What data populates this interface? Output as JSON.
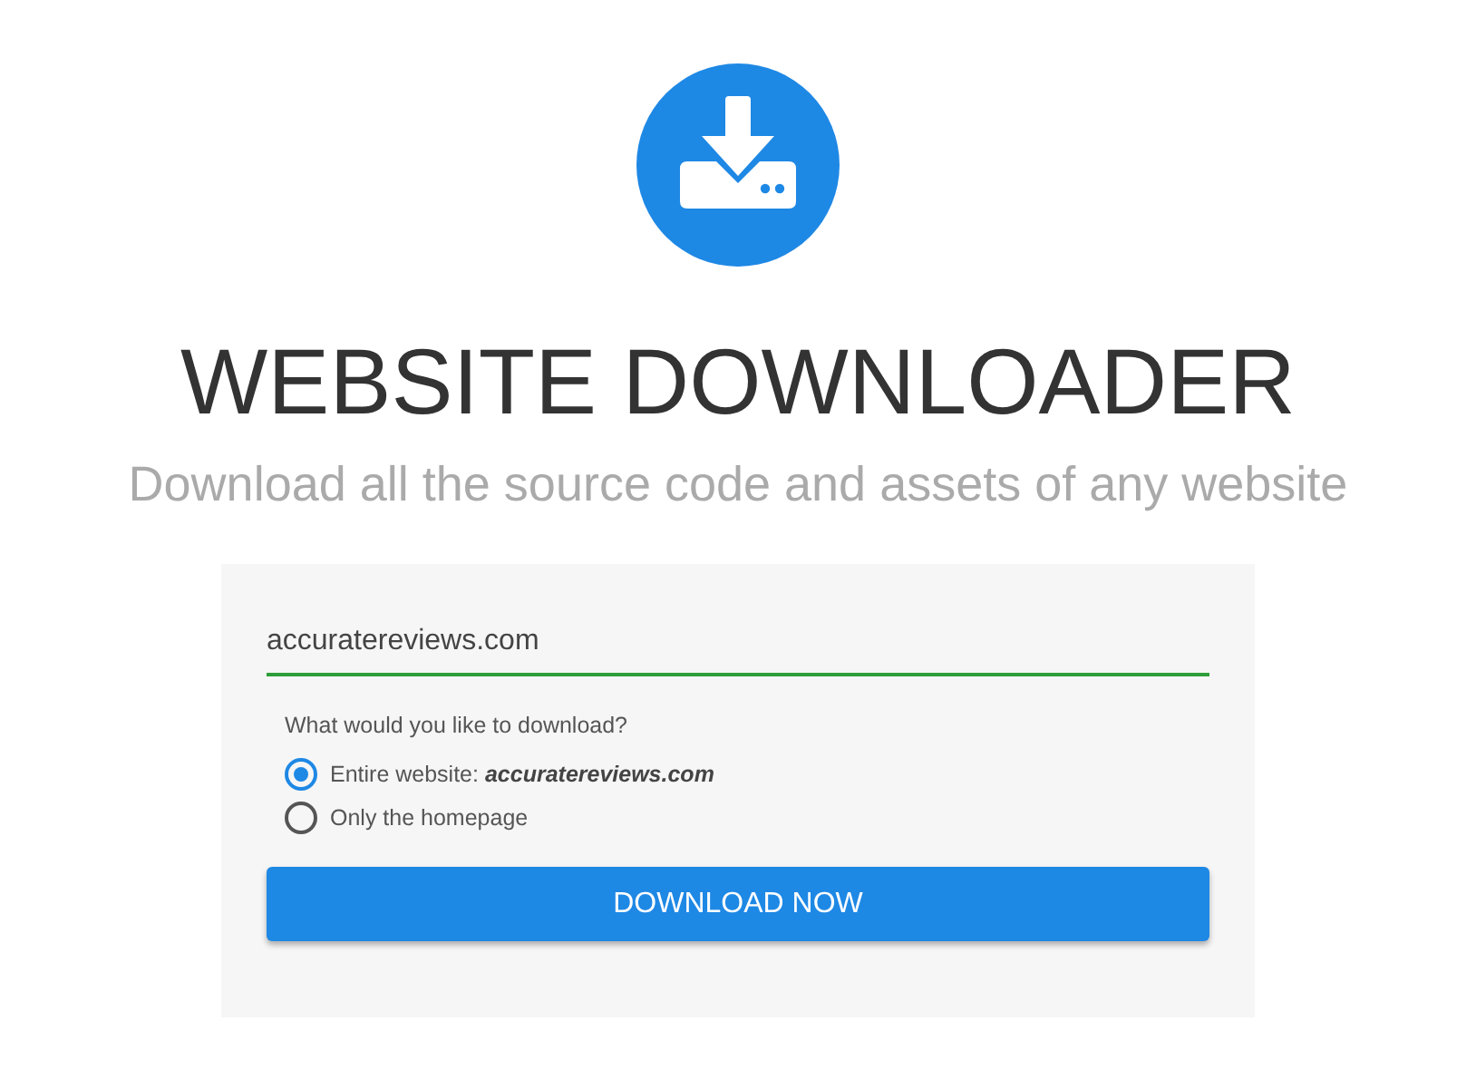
{
  "header": {
    "title": "WEBSITE DOWNLOADER",
    "subtitle": "Download all the source code and assets of any website"
  },
  "form": {
    "url_field": {
      "value": "accuratereviews.com"
    },
    "question": "What would you like to download?",
    "options": [
      {
        "label": "Entire website: **accuratereviews.com**",
        "selected": true
      },
      {
        "label": "Only the homepage",
        "selected": false
      }
    ],
    "button": "DOWNLOAD NOW"
  }
}
